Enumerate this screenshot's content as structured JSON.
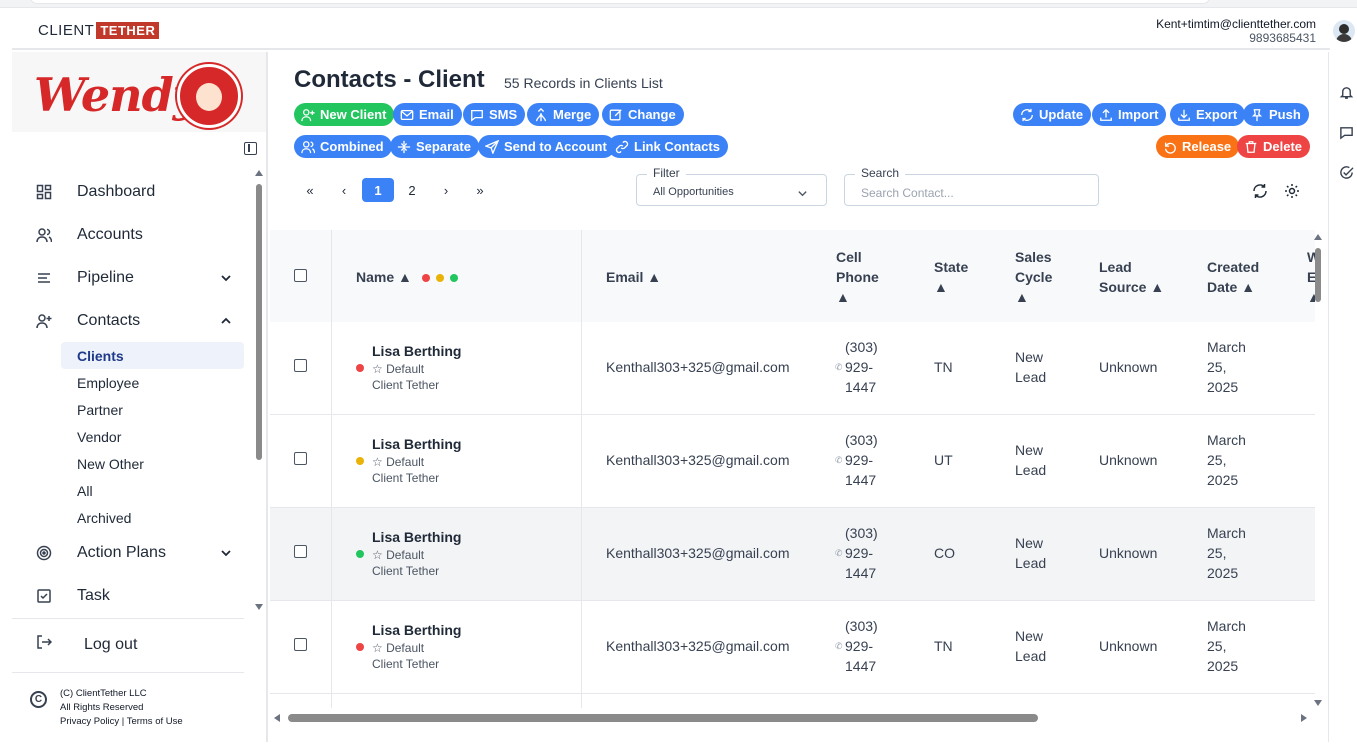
{
  "header": {
    "logo_client": "CLIENT",
    "logo_tether": "TETHER",
    "user_email": "Kent+timtim@clienttether.com",
    "user_phone": "9893685431"
  },
  "brand": {
    "name": "Wendy's"
  },
  "sidebar": {
    "items": [
      {
        "label": "Dashboard",
        "icon": "dashboard-icon"
      },
      {
        "label": "Accounts",
        "icon": "users-icon"
      },
      {
        "label": "Pipeline",
        "icon": "pipeline-icon"
      },
      {
        "label": "Contacts",
        "icon": "add-user-icon"
      }
    ],
    "contacts_sub": [
      "Clients",
      "Employee",
      "Partner",
      "Vendor",
      "New Other",
      "All",
      "Archived"
    ],
    "items2": [
      {
        "label": "Action Plans",
        "icon": "target-icon"
      },
      {
        "label": "Task",
        "icon": "checkbox-icon"
      }
    ],
    "logout": "Log out",
    "footer": {
      "line1": "(C) ClientTether LLC",
      "line2": "All Rights Reserved",
      "line3": "Privacy Policy | Terms of Use"
    }
  },
  "page": {
    "title": "Contacts - Client",
    "subtitle": "55 Records in Clients List"
  },
  "toolbar": {
    "new_client": "New Client",
    "email": "Email",
    "sms": "SMS",
    "merge": "Merge",
    "change": "Change",
    "combined": "Combined",
    "separate": "Separate",
    "send_to_account": "Send to Account",
    "link_contacts": "Link Contacts",
    "update": "Update",
    "import": "Import",
    "export": "Export",
    "push": "Push",
    "release": "Release",
    "delete": "Delete"
  },
  "pager": {
    "first": "«",
    "prev": "‹",
    "page1": "1",
    "page2": "2",
    "next": "›",
    "last": "»"
  },
  "filter": {
    "legend": "Filter",
    "value": "All Opportunities"
  },
  "search": {
    "legend": "Search",
    "placeholder": "Search Contact..."
  },
  "table": {
    "headers": {
      "name": "Name ▲",
      "email": "Email ▲",
      "cell1": "Cell",
      "cell2": "Phone",
      "state": "State",
      "sales1": "Sales",
      "sales2": "Cycle",
      "lead1": "Lead",
      "lead2": "Source ▲",
      "created1": "Created",
      "created2": "Date ▲",
      "arrow": "▲",
      "extra1": "W",
      "extra2": "E"
    },
    "rows": [
      {
        "name": "Lisa Berthing",
        "tag": "Default",
        "company": "Client Tether",
        "email": "Kenthall303+325@gmail.com",
        "phone1": "(303)",
        "phone2": "929-",
        "phone3": "1447",
        "state": "TN",
        "cycle1": "New",
        "cycle2": "Lead",
        "source": "Unknown",
        "date1": "March",
        "date2": "25,",
        "date3": "2025",
        "dot": "#ef4444"
      },
      {
        "name": "Lisa Berthing",
        "tag": "Default",
        "company": "Client Tether",
        "email": "Kenthall303+325@gmail.com",
        "phone1": "(303)",
        "phone2": "929-",
        "phone3": "1447",
        "state": "UT",
        "cycle1": "New",
        "cycle2": "Lead",
        "source": "Unknown",
        "date1": "March",
        "date2": "25,",
        "date3": "2025",
        "dot": "#eab308"
      },
      {
        "name": "Lisa Berthing",
        "tag": "Default",
        "company": "Client Tether",
        "email": "Kenthall303+325@gmail.com",
        "phone1": "(303)",
        "phone2": "929-",
        "phone3": "1447",
        "state": "CO",
        "cycle1": "New",
        "cycle2": "Lead",
        "source": "Unknown",
        "date1": "March",
        "date2": "25,",
        "date3": "2025",
        "dot": "#22c55e"
      },
      {
        "name": "Lisa Berthing",
        "tag": "Default",
        "company": "Client Tether",
        "email": "Kenthall303+325@gmail.com",
        "phone1": "(303)",
        "phone2": "929-",
        "phone3": "1447",
        "state": "TN",
        "cycle1": "New",
        "cycle2": "Lead",
        "source": "Unknown",
        "date1": "March",
        "date2": "25,",
        "date3": "2025",
        "dot": "#ef4444"
      }
    ]
  },
  "colors": {
    "primary": "#3b82f6",
    "success": "#22c55e",
    "warning": "#f97316",
    "danger": "#ef4444",
    "brand_red": "#d62828"
  }
}
